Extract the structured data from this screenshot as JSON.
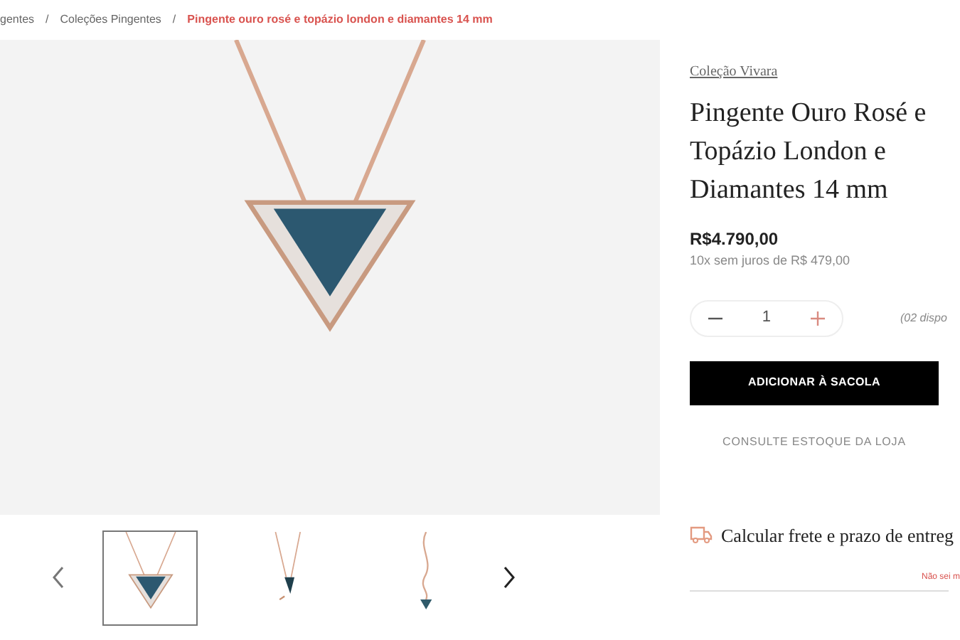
{
  "breadcrumb_separator": "/",
  "breadcrumb": [
    {
      "label": "gentes",
      "current": false
    },
    {
      "label": "Coleções Pingentes",
      "current": false
    },
    {
      "label": "Pingente ouro rosé e topázio london e diamantes 14 mm",
      "current": true
    }
  ],
  "gallery": {
    "thumbnails": [
      {
        "kind": "front",
        "selected": true
      },
      {
        "kind": "side",
        "selected": false
      },
      {
        "kind": "chain",
        "selected": false
      }
    ]
  },
  "product": {
    "collection": "Coleção Vivara",
    "title": "Pingente Ouro Rosé e Topázio London e Diamantes 14 mm",
    "price": "R$4.790,00",
    "installments": "10x sem juros de R$ 479,00",
    "quantity": "1",
    "stock_note": "(02 dispo",
    "add_button": "ADICIONAR À SACOLA",
    "store_stock_link": "CONSULTE ESTOQUE DA LOJA",
    "shipping": "Calcular frete e prazo de entreg",
    "zip_help": "Não sei m"
  }
}
